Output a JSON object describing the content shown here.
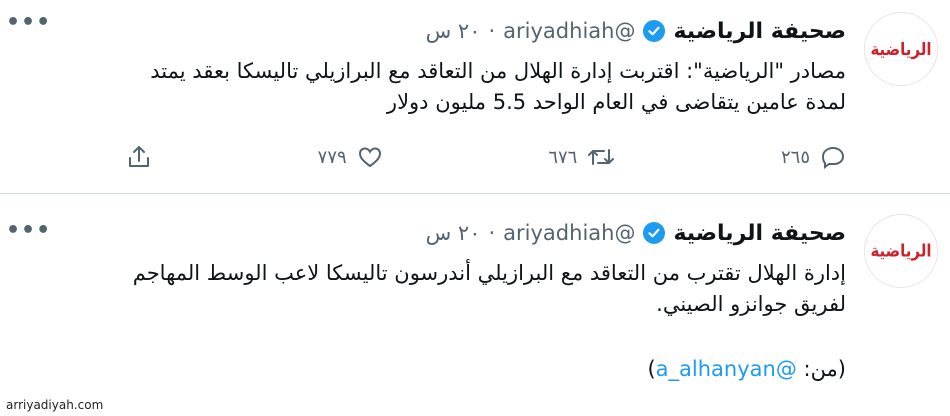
{
  "tweets": [
    {
      "display_name": "صحيفة الرياضية",
      "handle": "@ariyadhiah",
      "time": "٢٠ س",
      "text_lines": [
        "مصادر \"الرياضية\": اقتربت إدارة الهلال من التعاقد مع البرازيلي تاليسكا بعقد يمتد",
        "لمدة عامين يتقاضى في العام الواحد 5.5 مليون دولار"
      ],
      "replies": "٢٦٥",
      "retweets": "٦٧٦",
      "likes": "٧٧٩",
      "avatar_logo": "الرياضية"
    },
    {
      "display_name": "صحيفة الرياضية",
      "handle": "@ariyadhiah",
      "time": "٢٠ س",
      "text_lines": [
        "إدارة الهلال تقترب من التعاقد مع البرازيلي أندرسون تاليسكا لاعب الوسط المهاجم",
        "لفريق جوانزو الصيني."
      ],
      "credit_prefix": "(من: ",
      "credit_mention": "@a_alhanyan",
      "credit_suffix": ")",
      "avatar_logo": "الرياضية"
    }
  ],
  "watermark": "arriyadiyah.com",
  "colors": {
    "accent": "#1d9bf0",
    "muted": "#536471",
    "logo_red": "#d0202a"
  },
  "icons": [
    "more-icon",
    "verified-icon",
    "reply-icon",
    "retweet-icon",
    "like-icon",
    "share-icon"
  ]
}
